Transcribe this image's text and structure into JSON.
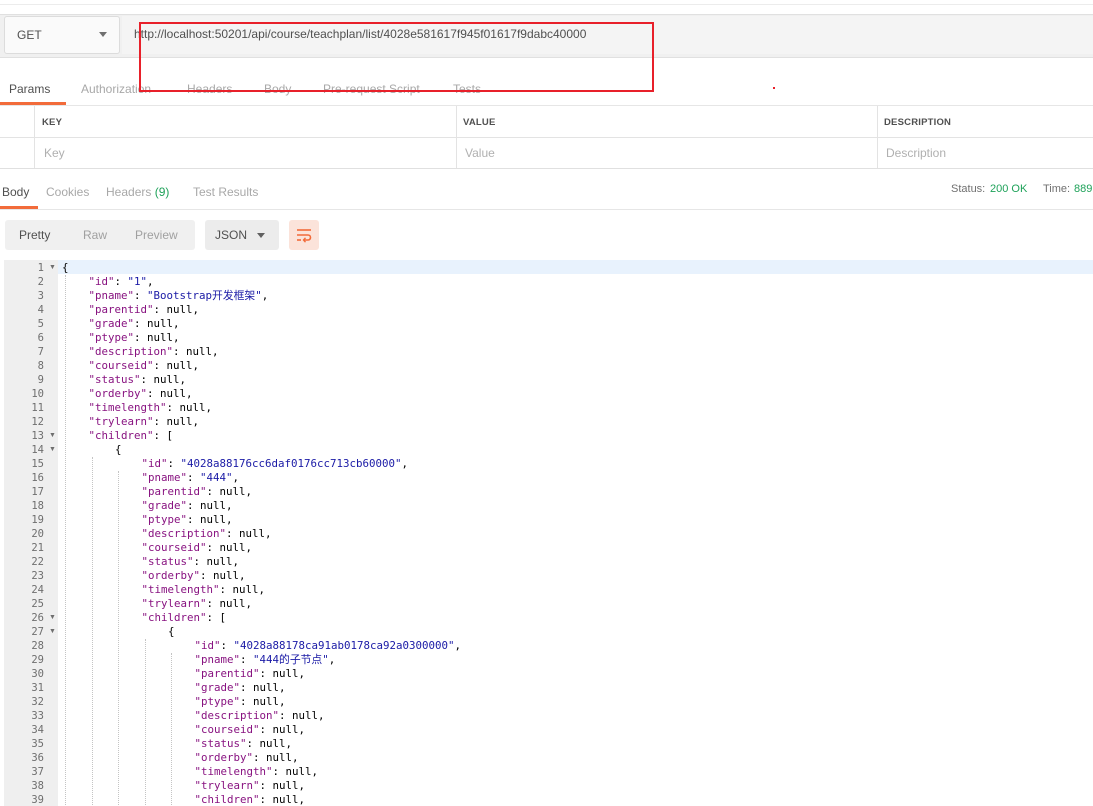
{
  "request": {
    "method": "GET",
    "url": "http://localhost:50201/api/course/teachplan/list/4028e581617f945f01617f9dabc40000"
  },
  "request_tabs": [
    "Params",
    "Authorization",
    "Headers",
    "Body",
    "Pre-request Script",
    "Tests"
  ],
  "params_table": {
    "headers": [
      "KEY",
      "VALUE",
      "DESCRIPTION"
    ],
    "placeholders": [
      "Key",
      "Value",
      "Description"
    ]
  },
  "response_tabs": {
    "body": "Body",
    "cookies": "Cookies",
    "headers": "Headers",
    "headers_count": "(9)",
    "test_results": "Test Results"
  },
  "status": {
    "status_label": "Status:",
    "status_value": "200 OK",
    "time_label": "Time:",
    "time_value": "889"
  },
  "view_modes": [
    "Pretty",
    "Raw",
    "Preview"
  ],
  "format": "JSON",
  "icons": {
    "wrap": "wrap-lines-icon",
    "chevron": "chevron-down-icon",
    "fold": "fold-arrow-icon"
  },
  "colors": {
    "accent": "#f26b3a",
    "status_ok": "#1fa25a",
    "highlight_box": "#e8202a",
    "json_key": "#881280",
    "json_string": "#1a1aa6"
  },
  "code_lines": [
    {
      "n": "1",
      "fold": true,
      "i": 0,
      "k": "",
      "s": "",
      "t": "{"
    },
    {
      "n": "2",
      "i": 1,
      "k": "\"id\"",
      "s": "\"1\"",
      "t": ","
    },
    {
      "n": "3",
      "i": 1,
      "k": "\"pname\"",
      "s": "\"Bootstrap开发框架\"",
      "t": ","
    },
    {
      "n": "4",
      "i": 1,
      "k": "\"parentid\"",
      "s": "",
      "t": "null,"
    },
    {
      "n": "5",
      "i": 1,
      "k": "\"grade\"",
      "s": "",
      "t": "null,"
    },
    {
      "n": "6",
      "i": 1,
      "k": "\"ptype\"",
      "s": "",
      "t": "null,"
    },
    {
      "n": "7",
      "i": 1,
      "k": "\"description\"",
      "s": "",
      "t": "null,"
    },
    {
      "n": "8",
      "i": 1,
      "k": "\"courseid\"",
      "s": "",
      "t": "null,"
    },
    {
      "n": "9",
      "i": 1,
      "k": "\"status\"",
      "s": "",
      "t": "null,"
    },
    {
      "n": "10",
      "i": 1,
      "k": "\"orderby\"",
      "s": "",
      "t": "null,"
    },
    {
      "n": "11",
      "i": 1,
      "k": "\"timelength\"",
      "s": "",
      "t": "null,"
    },
    {
      "n": "12",
      "i": 1,
      "k": "\"trylearn\"",
      "s": "",
      "t": "null,"
    },
    {
      "n": "13",
      "fold": true,
      "i": 1,
      "k": "\"children\"",
      "s": "",
      "t": "["
    },
    {
      "n": "14",
      "fold": true,
      "i": 2,
      "k": "",
      "s": "",
      "t": "{"
    },
    {
      "n": "15",
      "i": 3,
      "k": "\"id\"",
      "s": "\"4028a88176cc6daf0176cc713cb60000\"",
      "t": ","
    },
    {
      "n": "16",
      "i": 3,
      "k": "\"pname\"",
      "s": "\"444\"",
      "t": ","
    },
    {
      "n": "17",
      "i": 3,
      "k": "\"parentid\"",
      "s": "",
      "t": "null,"
    },
    {
      "n": "18",
      "i": 3,
      "k": "\"grade\"",
      "s": "",
      "t": "null,"
    },
    {
      "n": "19",
      "i": 3,
      "k": "\"ptype\"",
      "s": "",
      "t": "null,"
    },
    {
      "n": "20",
      "i": 3,
      "k": "\"description\"",
      "s": "",
      "t": "null,"
    },
    {
      "n": "21",
      "i": 3,
      "k": "\"courseid\"",
      "s": "",
      "t": "null,"
    },
    {
      "n": "22",
      "i": 3,
      "k": "\"status\"",
      "s": "",
      "t": "null,"
    },
    {
      "n": "23",
      "i": 3,
      "k": "\"orderby\"",
      "s": "",
      "t": "null,"
    },
    {
      "n": "24",
      "i": 3,
      "k": "\"timelength\"",
      "s": "",
      "t": "null,"
    },
    {
      "n": "25",
      "i": 3,
      "k": "\"trylearn\"",
      "s": "",
      "t": "null,"
    },
    {
      "n": "26",
      "fold": true,
      "i": 3,
      "k": "\"children\"",
      "s": "",
      "t": "["
    },
    {
      "n": "27",
      "fold": true,
      "i": 4,
      "k": "",
      "s": "",
      "t": "{"
    },
    {
      "n": "28",
      "i": 5,
      "k": "\"id\"",
      "s": "\"4028a88178ca91ab0178ca92a0300000\"",
      "t": ","
    },
    {
      "n": "29",
      "i": 5,
      "k": "\"pname\"",
      "s": "\"444的子节点\"",
      "t": ","
    },
    {
      "n": "30",
      "i": 5,
      "k": "\"parentid\"",
      "s": "",
      "t": "null,"
    },
    {
      "n": "31",
      "i": 5,
      "k": "\"grade\"",
      "s": "",
      "t": "null,"
    },
    {
      "n": "32",
      "i": 5,
      "k": "\"ptype\"",
      "s": "",
      "t": "null,"
    },
    {
      "n": "33",
      "i": 5,
      "k": "\"description\"",
      "s": "",
      "t": "null,"
    },
    {
      "n": "34",
      "i": 5,
      "k": "\"courseid\"",
      "s": "",
      "t": "null,"
    },
    {
      "n": "35",
      "i": 5,
      "k": "\"status\"",
      "s": "",
      "t": "null,"
    },
    {
      "n": "36",
      "i": 5,
      "k": "\"orderby\"",
      "s": "",
      "t": "null,"
    },
    {
      "n": "37",
      "i": 5,
      "k": "\"timelength\"",
      "s": "",
      "t": "null,"
    },
    {
      "n": "38",
      "i": 5,
      "k": "\"trylearn\"",
      "s": "",
      "t": "null,"
    },
    {
      "n": "39",
      "i": 5,
      "k": "\"children\"",
      "s": "",
      "t": "null,"
    }
  ]
}
